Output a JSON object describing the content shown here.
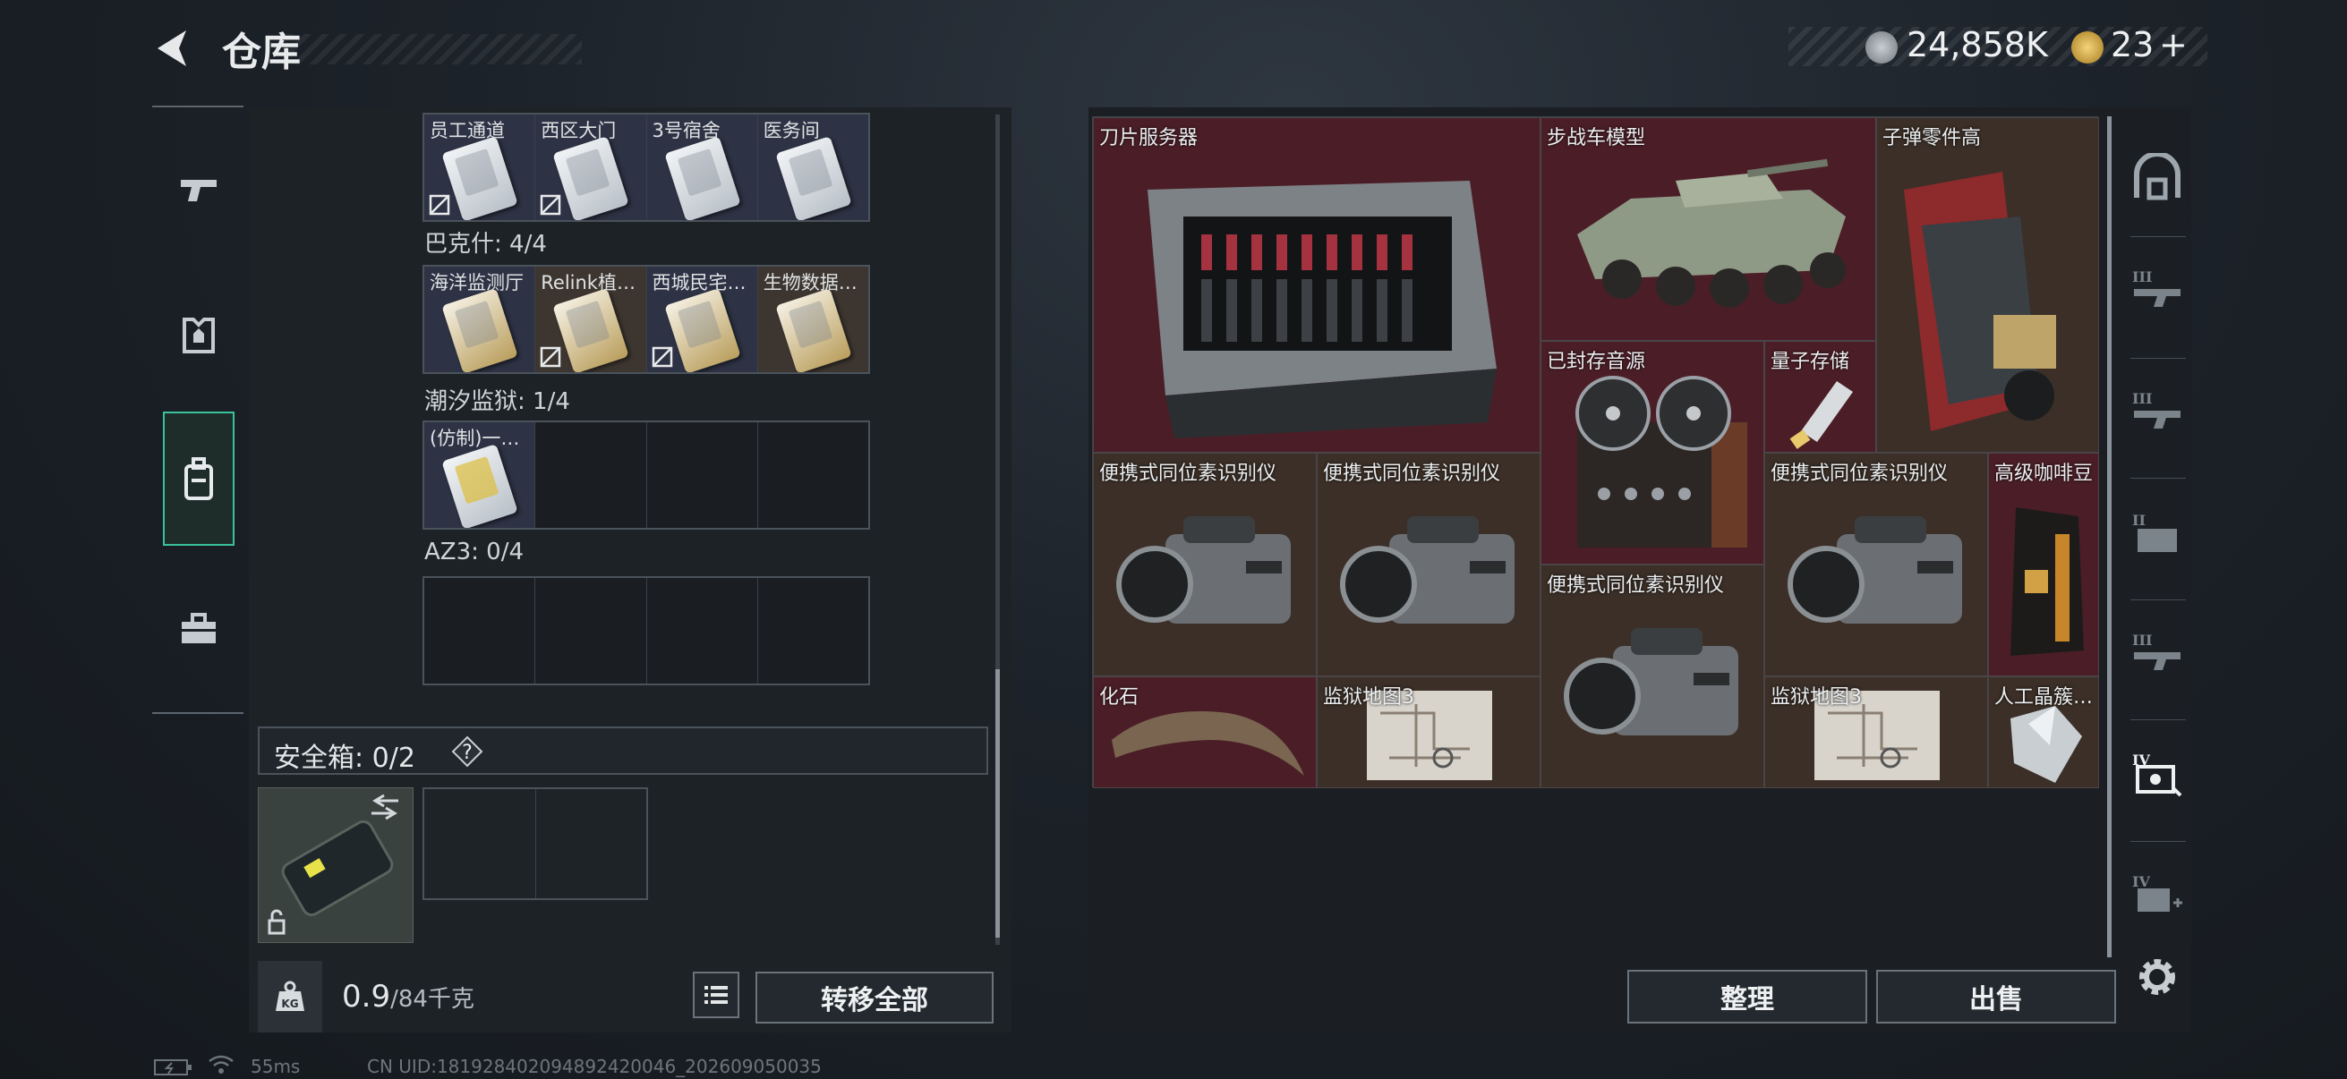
{
  "header": {
    "title": "仓库",
    "currency1": "24,858K",
    "currency2": "23",
    "currency2_plus": "+"
  },
  "sidebar_categories": [
    "weapon-icon",
    "armor-icon",
    "backpack-icon",
    "toolbox-icon"
  ],
  "left": {
    "groups": [
      {
        "label": "",
        "slots": [
          {
            "name": "员工通道",
            "locked": true
          },
          {
            "name": "西区大门",
            "locked": true
          },
          {
            "name": "3号宿舍",
            "locked": false
          },
          {
            "name": "医务间",
            "locked": false
          }
        ]
      },
      {
        "label": "巴克什: 4/4",
        "slots": [
          {
            "name": "海洋监测厅",
            "locked": false
          },
          {
            "name": "Relink植…",
            "locked": true
          },
          {
            "name": "西城民宅…",
            "locked": true
          },
          {
            "name": "生物数据…",
            "locked": false
          }
        ]
      },
      {
        "label": "潮汐监狱: 1/4",
        "slots": [
          {
            "name": "(仿制)一…",
            "locked": false
          }
        ]
      },
      {
        "label": "AZ3: 0/4",
        "slots": []
      }
    ],
    "safe_box": "安全箱: 0/2",
    "help": "?",
    "weight_value": "0.9",
    "weight_total": "/84千克",
    "weight_icon_label": "KG",
    "transfer_all": "转移全部"
  },
  "storage": {
    "items": [
      {
        "label": "刀片服务器"
      },
      {
        "label": "步战车模型"
      },
      {
        "label": "子弹零件高"
      },
      {
        "label": "已封存音源"
      },
      {
        "label": "量子存储"
      },
      {
        "label": "便携式同位素识别仪"
      },
      {
        "label": "便携式同位素识别仪"
      },
      {
        "label": "便携式同位素识别仪"
      },
      {
        "label": "高级咖啡豆"
      },
      {
        "label": "便携式同位素识别仪"
      },
      {
        "label": "化石"
      },
      {
        "label": "监狱地图3"
      },
      {
        "label": "监狱地图3"
      },
      {
        "label": "人工晶簇…"
      }
    ],
    "arrange": "整理",
    "sell": "出售"
  },
  "rail": [
    "home-icon",
    "III",
    "III",
    "II",
    "III",
    "IV",
    "IV",
    "settings-icon"
  ],
  "status": {
    "ping": "55ms",
    "uid": "CN UID:181928402094892420046_202609050035"
  }
}
